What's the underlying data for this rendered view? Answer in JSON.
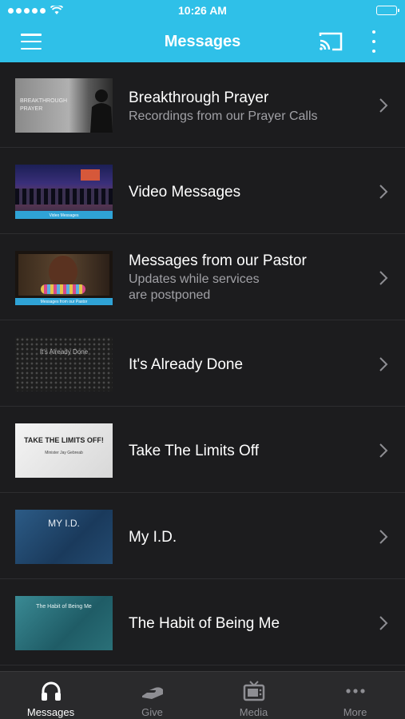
{
  "status": {
    "time": "10:26 AM"
  },
  "header": {
    "title": "Messages"
  },
  "messages": [
    {
      "title": "Breakthrough Prayer",
      "subtitle": "Recordings from our Prayer Calls",
      "thumb_text": "BREAKTHROUGH PRAYER"
    },
    {
      "title": "Video Messages",
      "subtitle": "",
      "thumb_text": "Video Messages"
    },
    {
      "title": "Messages from our Pastor",
      "subtitle_line1": "Updates while services",
      "subtitle_line2": "are postponed",
      "thumb_text": "Messages from our Pastor"
    },
    {
      "title": "It's Already Done",
      "subtitle": "",
      "thumb_text": "It's Already Done"
    },
    {
      "title": "Take The Limits Off",
      "subtitle": "",
      "thumb_text": "TAKE THE LIMITS OFF!",
      "thumb_sub": "Minister Jay Gebreab"
    },
    {
      "title": "My I.D.",
      "subtitle": "",
      "thumb_text": "MY I.D."
    },
    {
      "title": "The Habit of Being Me",
      "subtitle": "",
      "thumb_text": "The Habit of Being Me"
    }
  ],
  "tabs": [
    {
      "label": "Messages",
      "icon": "headphones-icon",
      "active": true
    },
    {
      "label": "Give",
      "icon": "give-hand-icon",
      "active": false
    },
    {
      "label": "Media",
      "icon": "tv-icon",
      "active": false
    },
    {
      "label": "More",
      "icon": "more-dots-icon",
      "active": false
    }
  ],
  "colors": {
    "accent": "#2fc0e8",
    "background": "#1c1c1e",
    "tabbar": "#2a2a2c"
  }
}
